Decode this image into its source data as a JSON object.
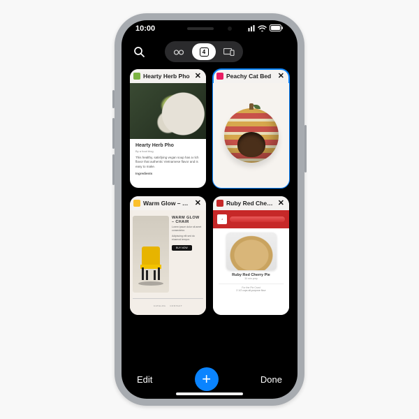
{
  "status": {
    "time": "10:00",
    "signal": "▪▪▪▪",
    "wifi": "᯾",
    "battery": "▮"
  },
  "mode_switch": {
    "tab_count": "4"
  },
  "tabs": [
    {
      "title": "Hearty Herb Pho",
      "favicon_color": "#7cb342",
      "selected": false,
      "content": {
        "heading": "Hearty Herb Pho",
        "byline": "By a food blog",
        "desc": "This healthy, satisfying vegan soup has a rich flavor that authentic Vietnamese flavor and is easy to make.",
        "sect": "Ingredients"
      }
    },
    {
      "title": "Peachy Cat Bed",
      "favicon_color": "#e91e63",
      "selected": true
    },
    {
      "title": "Warm Glow – Cha",
      "favicon_color": "#fbc02d",
      "selected": false,
      "content": {
        "heading": "WARM GLOW – CHAIR",
        "desc1": "Lorem ipsum dolor sit amet consectetur.",
        "desc2": "Adipiscing elit sed do eiusmod tempor.",
        "cta": "BUY NOW",
        "foot1": "CATALOG",
        "foot2": "CONTACT"
      }
    },
    {
      "title": "Ruby Red Cherry",
      "favicon_color": "#c62828",
      "selected": false,
      "content": {
        "logo": "J",
        "heading": "Ruby Red Cherry Pie",
        "sub": "30 min prep",
        "line1": "For the Pie Crust",
        "foot": "2 1/2 cups all-purpose flour"
      }
    }
  ],
  "bottom": {
    "edit": "Edit",
    "done": "Done",
    "plus": "+"
  }
}
